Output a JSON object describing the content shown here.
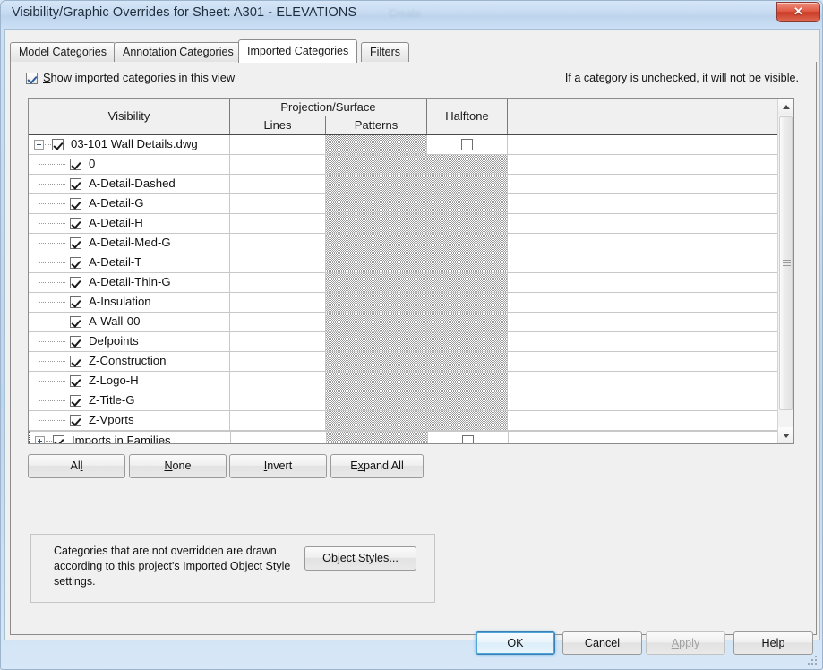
{
  "window": {
    "title": "Visibility/Graphic Overrides for Sheet: A301 - ELEVATIONS",
    "ghost_text": "Create",
    "close_glyph": "✕"
  },
  "tabs": [
    {
      "label": "Model Categories",
      "active": false
    },
    {
      "label": "Annotation Categories",
      "active": false
    },
    {
      "label": "Imported Categories",
      "active": true
    },
    {
      "label": "Filters",
      "active": false
    }
  ],
  "options": {
    "show_imported_label_prefix": "S",
    "show_imported_label_rest": "how imported categories in this view",
    "show_imported_checked": true,
    "hint": "If a category is unchecked, it will not be visible."
  },
  "table": {
    "headers": {
      "visibility": "Visibility",
      "projection_surface": "Projection/Surface",
      "lines": "Lines",
      "patterns": "Patterns",
      "halftone": "Halftone"
    },
    "rows": [
      {
        "label": "03-101 Wall Details.dwg",
        "level": 0,
        "checked": true,
        "expander": "minus",
        "halftone": "checkbox",
        "patterns_shaded": true
      },
      {
        "label": "0",
        "level": 1,
        "checked": true,
        "expander": "none",
        "halftone": "shaded",
        "patterns_shaded": true
      },
      {
        "label": "A-Detail-Dashed",
        "level": 1,
        "checked": true,
        "expander": "none",
        "halftone": "shaded",
        "patterns_shaded": true
      },
      {
        "label": "A-Detail-G",
        "level": 1,
        "checked": true,
        "expander": "none",
        "halftone": "shaded",
        "patterns_shaded": true
      },
      {
        "label": "A-Detail-H",
        "level": 1,
        "checked": true,
        "expander": "none",
        "halftone": "shaded",
        "patterns_shaded": true
      },
      {
        "label": "A-Detail-Med-G",
        "level": 1,
        "checked": true,
        "expander": "none",
        "halftone": "shaded",
        "patterns_shaded": true
      },
      {
        "label": "A-Detail-T",
        "level": 1,
        "checked": true,
        "expander": "none",
        "halftone": "shaded",
        "patterns_shaded": true
      },
      {
        "label": "A-Detail-Thin-G",
        "level": 1,
        "checked": true,
        "expander": "none",
        "halftone": "shaded",
        "patterns_shaded": true
      },
      {
        "label": "A-Insulation",
        "level": 1,
        "checked": true,
        "expander": "none",
        "halftone": "shaded",
        "patterns_shaded": true
      },
      {
        "label": "A-Wall-00",
        "level": 1,
        "checked": true,
        "expander": "none",
        "halftone": "shaded",
        "patterns_shaded": true
      },
      {
        "label": "Defpoints",
        "level": 1,
        "checked": true,
        "expander": "none",
        "halftone": "shaded",
        "patterns_shaded": true
      },
      {
        "label": "Z-Construction",
        "level": 1,
        "checked": true,
        "expander": "none",
        "halftone": "shaded",
        "patterns_shaded": true
      },
      {
        "label": "Z-Logo-H",
        "level": 1,
        "checked": true,
        "expander": "none",
        "halftone": "shaded",
        "patterns_shaded": true
      },
      {
        "label": "Z-Title-G",
        "level": 1,
        "checked": true,
        "expander": "none",
        "halftone": "shaded",
        "patterns_shaded": true
      },
      {
        "label": "Z-Vports",
        "level": 1,
        "checked": true,
        "expander": "none",
        "halftone": "shaded",
        "patterns_shaded": true
      },
      {
        "label": "Imports in Families",
        "level": 0,
        "checked": true,
        "expander": "plus",
        "halftone": "checkbox",
        "patterns_shaded": true,
        "focused": true
      }
    ],
    "scrollbar": {
      "up_glyph": "▲",
      "down_glyph": "▼"
    }
  },
  "actions": {
    "all": {
      "mnemonic": "l",
      "before": "Al",
      "after": ""
    },
    "none": {
      "mnemonic": "N",
      "before": "",
      "after": "one"
    },
    "invert": {
      "mnemonic": "I",
      "before": "",
      "after": "nvert"
    },
    "expand": {
      "mnemonic": "x",
      "before": "E",
      "after": "pand All"
    }
  },
  "info": {
    "text": "Categories that are not overridden are drawn according to this project's Imported Object Style settings.",
    "object_styles": {
      "mnemonic": "O",
      "before": "",
      "after": "bject Styles..."
    }
  },
  "footer": {
    "ok": "OK",
    "cancel": "Cancel",
    "apply": {
      "mnemonic": "A",
      "before": "",
      "after": "pply",
      "disabled": true
    },
    "help": "Help"
  }
}
